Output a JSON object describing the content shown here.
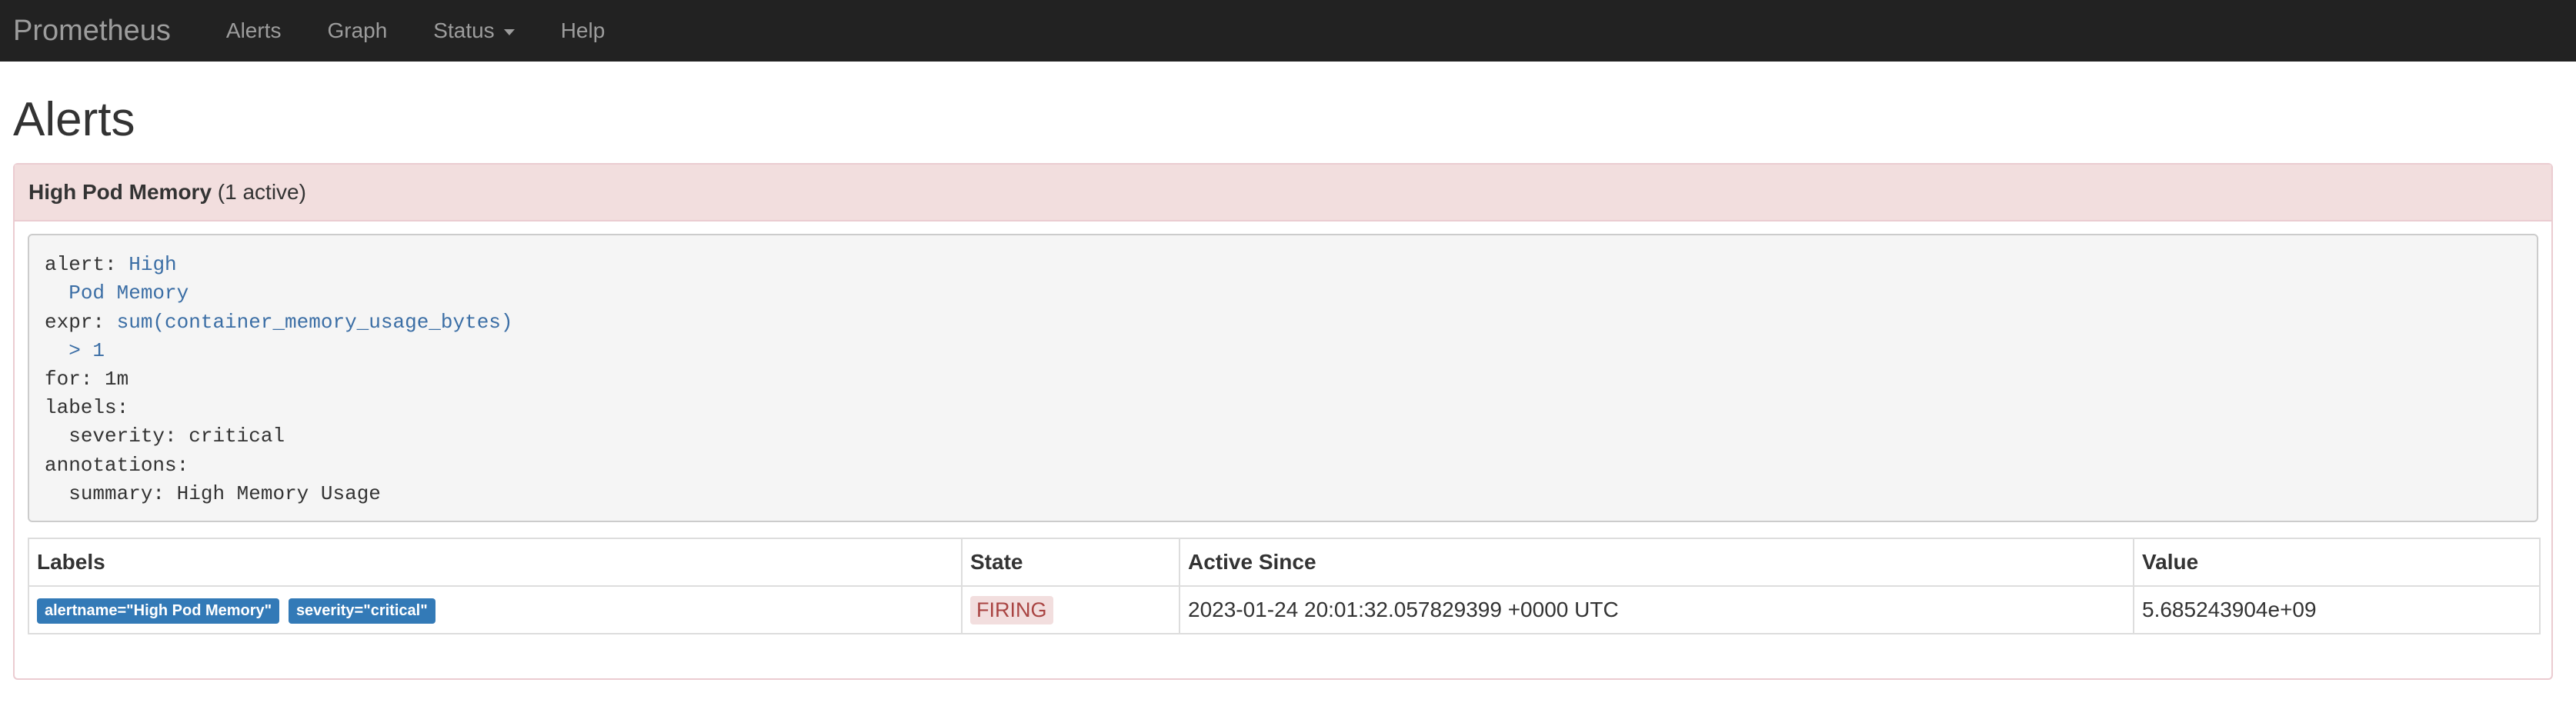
{
  "navbar": {
    "brand": "Prometheus",
    "items": [
      {
        "label": "Alerts"
      },
      {
        "label": "Graph"
      },
      {
        "label": "Status"
      },
      {
        "label": "Help"
      }
    ]
  },
  "page": {
    "title": "Alerts"
  },
  "alert_group": {
    "name": "High Pod Memory",
    "active_text": "(1 active)",
    "rule": {
      "alert_key": "alert:",
      "alert_line1": "High",
      "alert_line2": "Pod Memory",
      "expr_key": "expr:",
      "expr_line1": "sum(container_memory_usage_bytes)",
      "expr_line2": "> 1",
      "for_key": "for:",
      "for_value": "1m",
      "labels_key": "labels:",
      "severity_key": "severity:",
      "severity_value": "critical",
      "annotations_key": "annotations:",
      "summary_key": "summary:",
      "summary_value": "High Memory Usage"
    },
    "table": {
      "headers": [
        "Labels",
        "State",
        "Active Since",
        "Value"
      ],
      "rows": [
        {
          "labels": [
            "alertname=\"High Pod Memory\"",
            "severity=\"critical\""
          ],
          "state": "FIRING",
          "active_since": "2023-01-24 20:01:32.057829399 +0000 UTC",
          "value": "5.685243904e+09"
        }
      ]
    }
  },
  "colors": {
    "navbar_bg": "#222222",
    "panel_heading_bg": "#f2dede",
    "label_badge": "#337ab7",
    "firing_text": "#a94442"
  }
}
